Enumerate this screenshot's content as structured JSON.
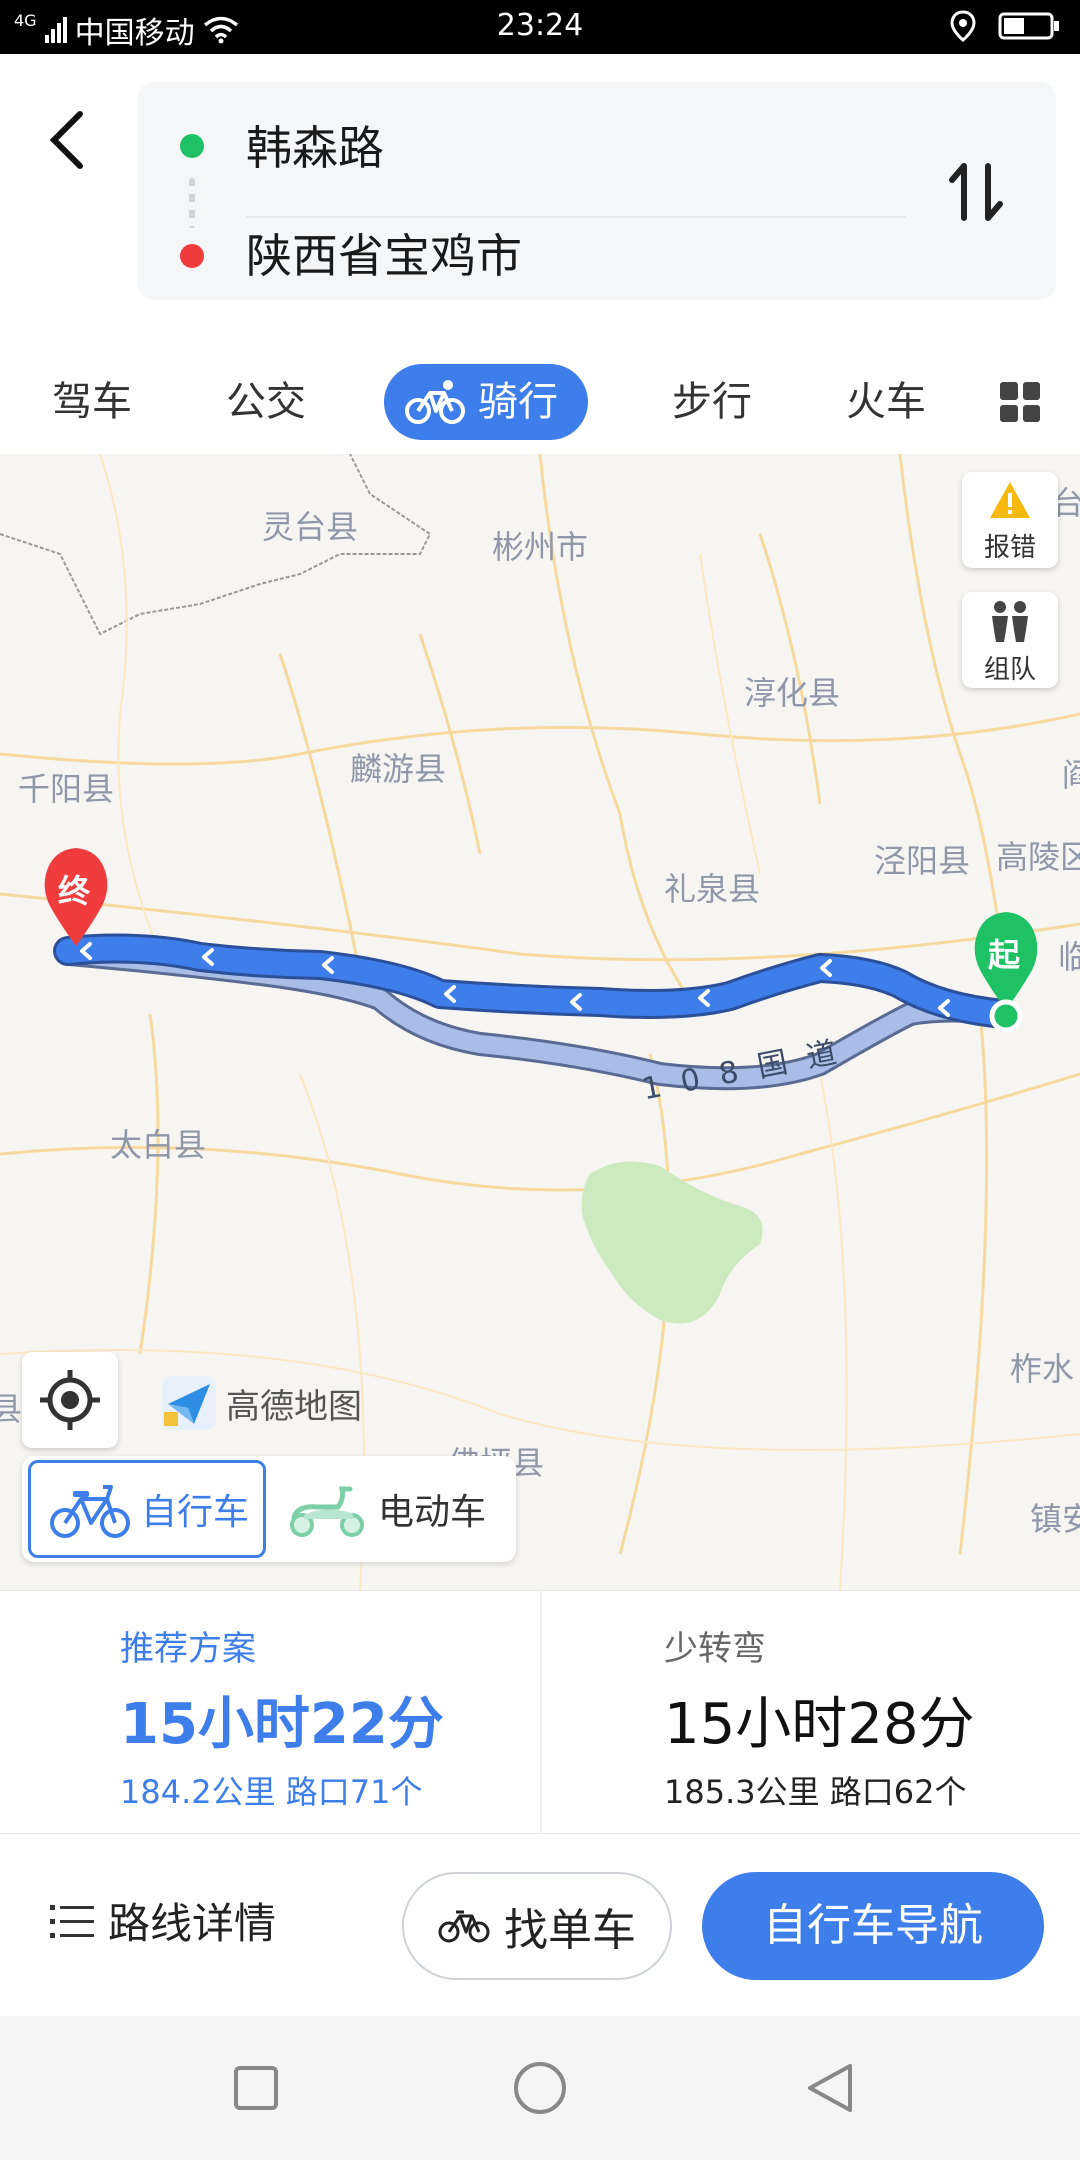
{
  "status_bar": {
    "network": "4G",
    "carrier": "中国移动",
    "time": "23:24"
  },
  "route": {
    "start": "韩森路",
    "end": "陕西省宝鸡市"
  },
  "modes": [
    {
      "label": "驾车"
    },
    {
      "label": "公交"
    },
    {
      "label": "骑行",
      "active": true
    },
    {
      "label": "步行"
    },
    {
      "label": "火车"
    }
  ],
  "map": {
    "cities": [
      "灵台县",
      "彬州市",
      "淳化县",
      "千阳县",
      "麟游县",
      "泾阳县",
      "高陵区",
      "礼泉县",
      "太白县",
      "柞水",
      "佛坪县",
      "镇安",
      "临",
      "台",
      "阎",
      "县"
    ],
    "road_label": "108国道",
    "start_marker": "起",
    "end_marker": "终",
    "report_label": "报错",
    "team_label": "组队",
    "logo_text": "高德地图",
    "vehicle_options": [
      "自行车",
      "电动车"
    ]
  },
  "plans": [
    {
      "title": "推荐方案",
      "time": "15小时22分",
      "detail": "184.2公里 路口71个"
    },
    {
      "title": "少转弯",
      "time": "15小时28分",
      "detail": "185.3公里 路口62个"
    }
  ],
  "actions": {
    "details": "路线详情",
    "find_bike": "找单车",
    "navigate": "自行车导航"
  },
  "colors": {
    "accent": "#3d7eea",
    "route_main": "#3d7eea",
    "route_alt": "#a9bde6",
    "start_green": "#1ec265",
    "end_red": "#f03c3c"
  }
}
